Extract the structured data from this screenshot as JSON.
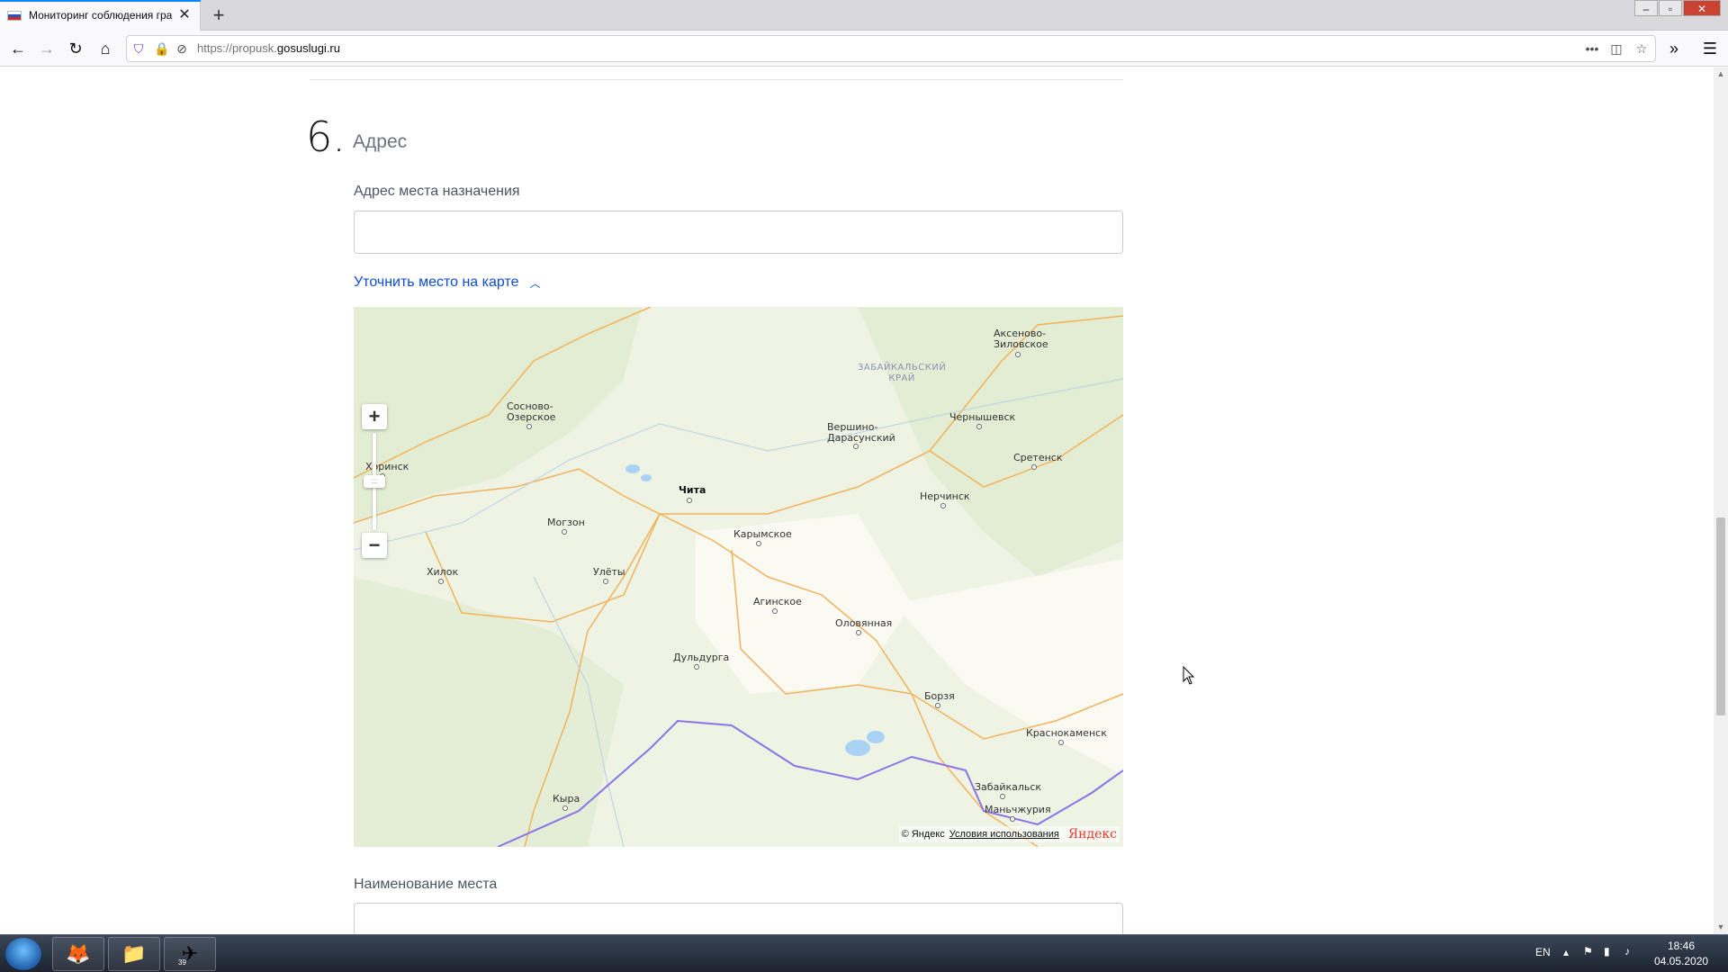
{
  "browser": {
    "tab_title": "Мониторинг соблюдения гра",
    "url_base": "https://propusk.",
    "url_domain": "gosuslugi.ru",
    "icons": {
      "back": "arrow-left-icon",
      "forward": "arrow-right-icon",
      "reload": "reload-icon",
      "home": "home-icon",
      "shield": "shield-icon",
      "lock": "lock-icon",
      "more": "more-dots-icon",
      "pocket": "pocket-icon",
      "bookmark": "star-icon",
      "overflow": "chevrons-right-icon",
      "menu": "hamburger-icon"
    }
  },
  "form": {
    "section_number": "6.",
    "section_title": "Адрес",
    "address_label": "Адрес места назначения",
    "address_value": "",
    "map_toggle_label": "Уточнить место на карте",
    "place_name_label": "Наименование места",
    "place_name_value": ""
  },
  "map": {
    "region_label": "ЗАБАЙКАЛЬСКИЙ\nКРАЙ",
    "cities": [
      {
        "name": "Аксеново-\nЗиловское"
      },
      {
        "name": "Сосново-\nОзерское"
      },
      {
        "name": "Хоринск"
      },
      {
        "name": "Вершино-\nДарасунский"
      },
      {
        "name": "Чернышевск"
      },
      {
        "name": "Сретенск"
      },
      {
        "name": "Чита"
      },
      {
        "name": "Нерчинск"
      },
      {
        "name": "Могзон"
      },
      {
        "name": "Карымское"
      },
      {
        "name": "Хилок"
      },
      {
        "name": "Улёты"
      },
      {
        "name": "Агинское"
      },
      {
        "name": "Оловянная"
      },
      {
        "name": "Дульдурга"
      },
      {
        "name": "Борзя"
      },
      {
        "name": "Краснокаменск"
      },
      {
        "name": "Забайкальск"
      },
      {
        "name": "Маньчжурия"
      },
      {
        "name": "Кыра"
      }
    ],
    "copyright": "© Яндекс",
    "terms": "Условия использования",
    "logo": "Яндекс",
    "zoom_in": "+",
    "zoom_out": "−",
    "zoom_handle": ":::"
  },
  "taskbar": {
    "lang": "EN",
    "time": "18:46",
    "date": "04.05.2020",
    "telegram_badge": "39"
  }
}
